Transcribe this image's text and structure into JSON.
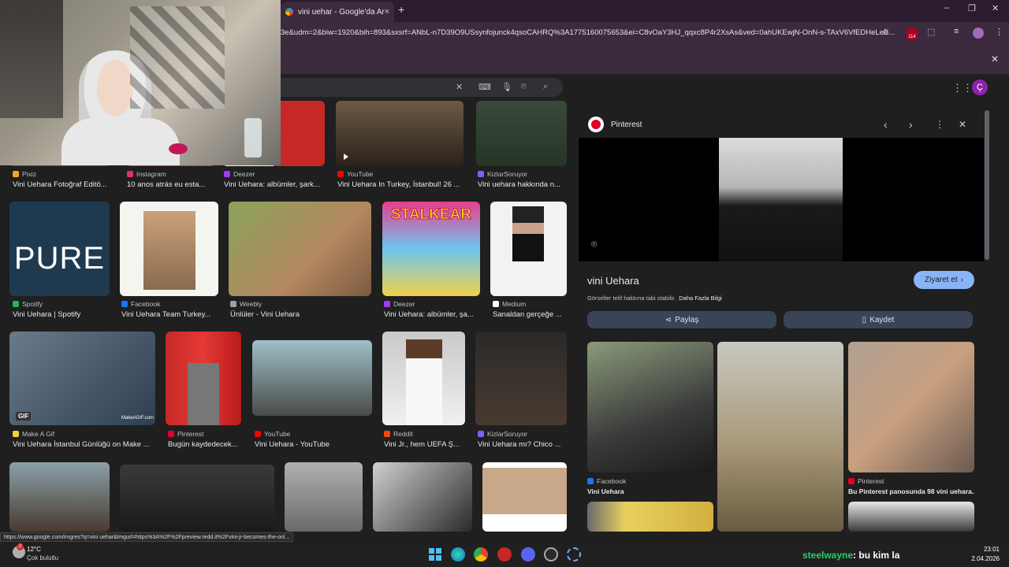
{
  "browser": {
    "tab_title": "vini uehar - Google'da Ara",
    "tab_close": "×",
    "new_tab": "+",
    "url": "3e&udm=2&biw=1920&bih=893&sxsrf=ANbL-n7D39O9USsynfojunck4qsoCAHRQ%3A1775160075653&ei=C8vOaY3HJ_qqxc8P4r2XsAs&ved=0ahUKEwjN-OnN-s-TAxV6VfEDHeLeB...",
    "badge": "114",
    "window_minimize": "–",
    "window_restore": "❐",
    "window_close": "✕",
    "bar_close": "✕"
  },
  "google": {
    "search_clear": "✕",
    "avatar_letter": "Ç"
  },
  "results": [
    {
      "source": "Pixiz",
      "caption": "Vini Uehara Fotoğraf Editö...",
      "color": "#f5a623"
    },
    {
      "source": "Instagram",
      "caption": "10 anos atrás eu esta...",
      "color": "#e1306c"
    },
    {
      "source": "Deezer",
      "caption": "Vini Uehara: albümler, şark...",
      "color": "#a238ff"
    },
    {
      "source": "YouTube",
      "caption": "Vini Uehara In Turkey, İstanbul! 26 ...",
      "color": "#ff0000"
    },
    {
      "source": "KizlarSoruyor",
      "caption": "Vini uehara hakkında n...",
      "color": "#7b61ff"
    },
    {
      "source": "Spotify",
      "caption": "Vini Uehara | Spotify",
      "color": "#1db954"
    },
    {
      "source": "Facebook",
      "caption": "Vini Uehara Team Turkey...",
      "color": "#1877f2"
    },
    {
      "source": "Weebly",
      "caption": "Ünlüler - Vini Uehara",
      "color": "#9aa0a6"
    },
    {
      "source": "Deezer",
      "caption": "Vini Uehara: albümler, şa...",
      "color": "#a238ff"
    },
    {
      "source": "Medium",
      "caption": "Sanaldan gerçeğe ...",
      "color": "#ffffff"
    },
    {
      "source": "Make A Gif",
      "caption": "Vini Uehara İstanbul Günlüğü on Make ...",
      "color": "#f4d03f"
    },
    {
      "source": "Pinterest",
      "caption": "Bugün kaydedecek...",
      "color": "#e60023"
    },
    {
      "source": "YouTube",
      "caption": "Vini Uehara - YouTube",
      "color": "#ff0000"
    },
    {
      "source": "Reddit",
      "caption": "Vini Jr., hem UEFA Ş...",
      "color": "#ff4500"
    },
    {
      "source": "KizlarSoruyor",
      "caption": "Vini Uehara mı? Chico ...",
      "color": "#7b61ff"
    }
  ],
  "thumb_text": {
    "pure": "PURE",
    "stalkear": "STALKEAR",
    "gif": "GIF",
    "makeagif": "MakeAGIF.com"
  },
  "panel": {
    "source": "Pinterest",
    "title": "vini Uehara",
    "visit": "Ziyaret et",
    "copyright": "Görseller telif hakkına tabi olabilir.",
    "more_info": "Daha Fazla Bilgi",
    "share": "Paylaş",
    "save": "Kaydet",
    "related": [
      {
        "source": "Facebook",
        "caption": "Vini Uehara"
      },
      {
        "source": "Pinterest",
        "caption": "Bu Pinterest panosunda 98 vini uehara..."
      }
    ]
  },
  "status_url": "https://www.google.com/imgres?q=vini uehar&imgurl=https%3A%2F%2Fpreview.redd.it%2Fvini-jr-becomes-the-onl...",
  "taskbar": {
    "temperature": "12°C",
    "weather": "Çok bulutlu",
    "weather_badge": "2",
    "time": "23:01",
    "date": "2.04.2026",
    "chat_user": "steelwayne",
    "chat_message": ": bu kim la"
  }
}
